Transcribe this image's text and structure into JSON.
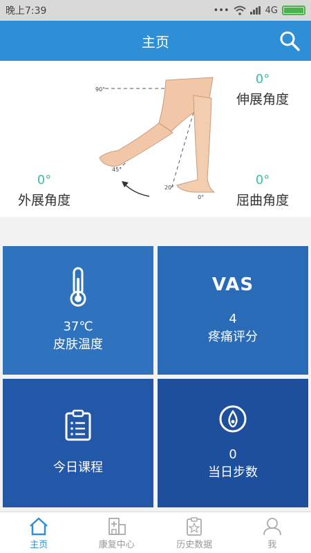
{
  "status_bar": {
    "time": "晚上7:39",
    "network": "4G",
    "battery_level": 1.0
  },
  "header": {
    "title": "主页",
    "search_icon": "search-icon"
  },
  "angles": {
    "extension": {
      "value": "0°",
      "label": "伸展角度"
    },
    "abduction": {
      "value": "0°",
      "label": "外展角度"
    },
    "flexion": {
      "value": "0°",
      "label": "屈曲角度"
    }
  },
  "diagram_labels": {
    "a90": "90°",
    "a45": "45°",
    "a20": "20°",
    "a0": "0°"
  },
  "tiles": {
    "skin_temp": {
      "value": "37℃",
      "label": "皮肤温度",
      "icon": "thermometer-icon",
      "color": "#2f72be"
    },
    "pain": {
      "badge": "VAS",
      "value": "4",
      "label": "疼痛评分",
      "color": "#2a6bb8"
    },
    "course": {
      "label": "今日课程",
      "icon": "clipboard-icon",
      "color": "#2358a8"
    },
    "steps": {
      "value": "0",
      "label": "当日步数",
      "icon": "steps-icon",
      "color": "#1e4f9c"
    }
  },
  "tabbar": {
    "active_color": "#2f8fd6",
    "items": [
      {
        "label": "主页",
        "icon": "home-icon"
      },
      {
        "label": "康复中心",
        "icon": "hospital-icon"
      },
      {
        "label": "历史数据",
        "icon": "history-icon"
      },
      {
        "label": "我",
        "icon": "user-icon"
      }
    ]
  }
}
